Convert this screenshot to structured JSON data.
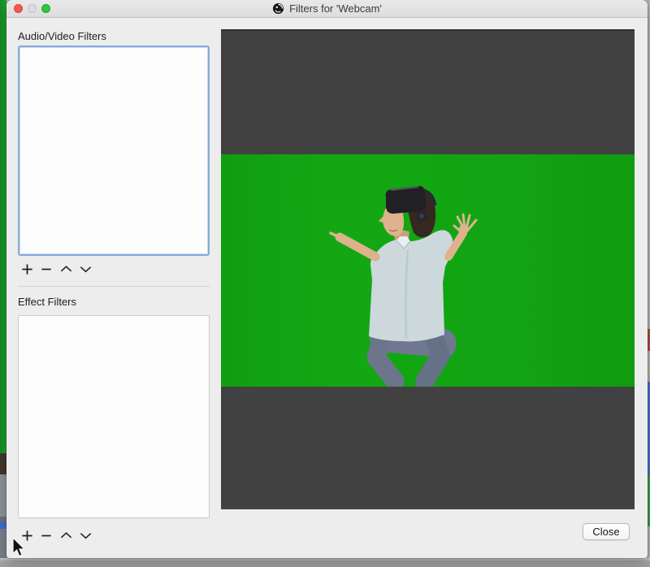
{
  "window": {
    "title": "Filters for 'Webcam'",
    "titlebar_icon": "obs-logo-icon",
    "traffic_lights": {
      "close_color": "#f2594f",
      "minimize_disabled_color": "#dcdcdc",
      "zoom_color": "#2dc63f"
    }
  },
  "filters": {
    "audio_video_label": "Audio/Video Filters",
    "audio_video_items": [],
    "effect_label": "Effect Filters",
    "effect_items": []
  },
  "filter_toolbar_icons": [
    "plus-icon",
    "minus-icon",
    "chevron-up-icon",
    "chevron-down-icon"
  ],
  "buttons": {
    "close_label": "Close"
  },
  "preview": {
    "background_color": "#414141",
    "chroma_green_color": "#12a312",
    "content": "man-wearing-vr-headset-dancing-on-green-screen"
  }
}
